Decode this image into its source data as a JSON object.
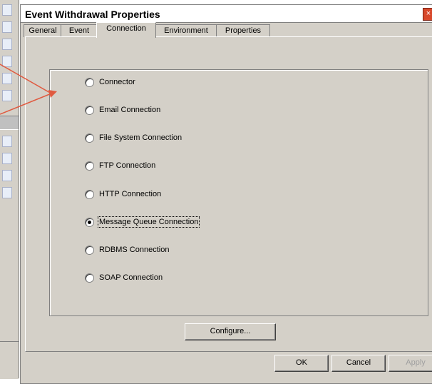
{
  "dialog": {
    "title": "Event Withdrawal Properties",
    "close_glyph": "×"
  },
  "tabs": [
    {
      "label": "General",
      "active": false
    },
    {
      "label": "Event",
      "active": false
    },
    {
      "label": "Connection",
      "active": true
    },
    {
      "label": "Environment",
      "active": false
    },
    {
      "label": "Properties",
      "active": false
    }
  ],
  "connection_options": [
    {
      "label": "Connector",
      "selected": false
    },
    {
      "label": "Email Connection",
      "selected": false
    },
    {
      "label": "File System Connection",
      "selected": false
    },
    {
      "label": "FTP Connection",
      "selected": false
    },
    {
      "label": "HTTP Connection",
      "selected": false
    },
    {
      "label": "Message Queue Connection",
      "selected": true
    },
    {
      "label": "RDBMS Connection",
      "selected": false
    },
    {
      "label": "SOAP Connection",
      "selected": false
    }
  ],
  "configure_label": "Configure...",
  "footer": {
    "ok_label": "OK",
    "cancel_label": "Cancel",
    "apply_label": "Apply"
  },
  "colors": {
    "annotation_arrow": "#e05a40",
    "title_close": "#d8492c"
  }
}
